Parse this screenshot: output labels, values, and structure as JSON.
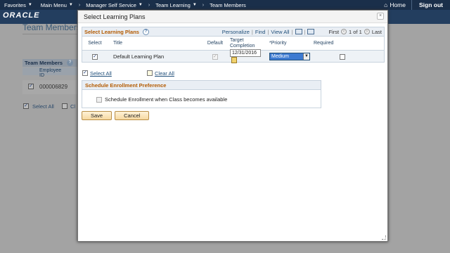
{
  "topnav": {
    "items": [
      "Favorites",
      "Main Menu",
      "Manager Self Service",
      "Team Learning",
      "Team Members"
    ],
    "home_label": "Home",
    "signout_label": "Sign out"
  },
  "brand": {
    "logo_text": "ORACLE"
  },
  "background_page": {
    "title": "Team Members",
    "grid_title": "Team Members",
    "col_employee_id": "Employee ID",
    "employee_id": "000006829",
    "select_all": "Select All",
    "clear_all": "Cl"
  },
  "modal": {
    "title": "Select Learning Plans",
    "close": "×",
    "grid": {
      "title": "Select Learning Plans",
      "help": "?",
      "personalize": "Personalize",
      "find": "Find",
      "view_all": "View All",
      "first": "First",
      "page_info": "1 of 1",
      "last": "Last",
      "columns": {
        "select": "Select",
        "title": "Title",
        "default": "Default",
        "target_completion": "Target Completion",
        "priority": "*Priority",
        "required": "Required"
      },
      "rows": [
        {
          "selected": true,
          "title": "Default Learning Plan",
          "default": true,
          "target_completion": "12/31/2016",
          "priority": "Medium",
          "required": false
        }
      ]
    },
    "select_all": "Select All",
    "clear_all": "Clear All",
    "section": {
      "title": "Schedule Enrollment Preference",
      "option_label": "Schedule Enrollment when Class becomes available"
    },
    "buttons": {
      "save": "Save",
      "cancel": "Cancel"
    }
  },
  "colors": {
    "topnav_bg": "#1a2f4a",
    "accent_orange": "#b35a00",
    "link_blue": "#1f4e79",
    "selection_blue": "#3d7ad1"
  }
}
